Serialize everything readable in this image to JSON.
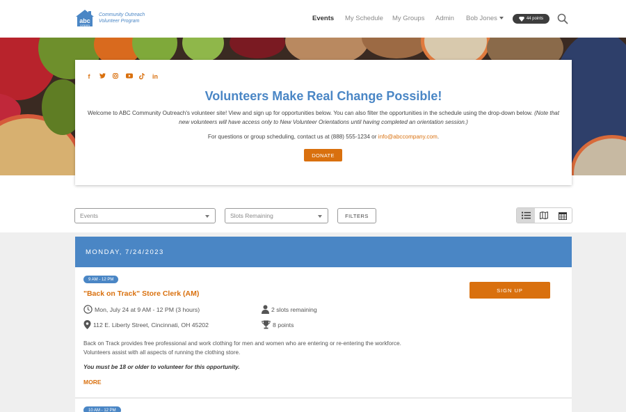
{
  "brand": {
    "logo_text": "abc",
    "logo_subtext": "company",
    "line1": "Community Outreach",
    "line2": "Volunteer Program"
  },
  "nav": {
    "items": [
      "Events",
      "My Schedule",
      "My Groups",
      "Admin"
    ],
    "user": "Bob Jones",
    "points": "44 points"
  },
  "social_icons": [
    "facebook-icon",
    "twitter-icon",
    "instagram-icon",
    "youtube-icon",
    "tiktok-icon",
    "linkedin-icon"
  ],
  "intro": {
    "title": "Volunteers Make Real Change Possible!",
    "welcome": "Welcome to ABC Community Outreach's volunteer site! View and sign up for opportunities below. You can also filter the opportunities in the schedule using the drop-down below.",
    "note": "(Note that new volunteers will have access only to New Volunteer Orientations until having completed an orientation session.)",
    "contact_prefix": "For questions or group scheduling, contact us at (888) 555-1234 or ",
    "contact_email": "info@abccompany.com",
    "contact_suffix": ".",
    "donate_label": "DONATE"
  },
  "filters": {
    "events_value": "Events",
    "slots_value": "Slots Remaining",
    "filters_label": "FILTERS"
  },
  "schedule": {
    "day_label": "MONDAY, 7/24/2023",
    "events": [
      {
        "time_badge": "9 AM - 12 PM",
        "title": "\"Back on Track\" Store Clerk (AM)",
        "datetime": "Mon, July 24 at 9 AM - 12 PM (3 hours)",
        "slots": "2 slots remaining",
        "location": "112 E. Liberty Street, Cincinnati, OH 45202",
        "points": "8 points",
        "description": "Back on Track provides free professional and work clothing for men and women who are entering or re-entering the workforce. Volunteers assist with all aspects of running the clothing store.",
        "requirement": "You must be 18 or older to volunteer for this opportunity.",
        "more_label": "MORE",
        "signup_label": "SIGN UP"
      },
      {
        "time_badge": "10 AM - 12 PM"
      }
    ]
  },
  "colors": {
    "accent_blue": "#4a86c5",
    "accent_orange": "#d9700e"
  }
}
